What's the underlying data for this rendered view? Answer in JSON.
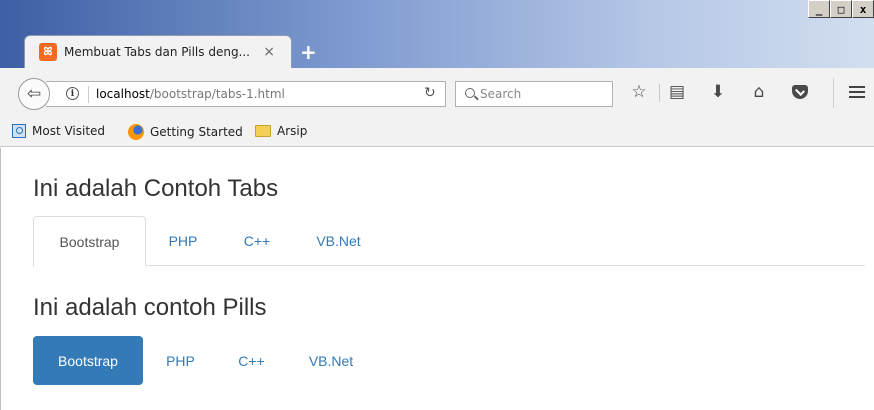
{
  "window": {
    "controls": {
      "minimize": "_",
      "maximize": "□",
      "close": "x"
    }
  },
  "browser_tab": {
    "title": "Membuat Tabs dan Pills deng...",
    "favicon_glyph": "ꕤ",
    "close_glyph": "×"
  },
  "new_tab": "+",
  "toolbar": {
    "url_host": "localhost",
    "url_path": "/bootstrap/tabs-1.html",
    "search_placeholder": "Search"
  },
  "bookmarks": [
    {
      "label": "Most Visited"
    },
    {
      "label": "Getting Started"
    },
    {
      "label": "Arsip"
    }
  ],
  "page": {
    "tabs_heading": "Ini adalah Contoh Tabs",
    "tabs": [
      {
        "label": "Bootstrap",
        "active": true
      },
      {
        "label": "PHP",
        "active": false
      },
      {
        "label": "C++",
        "active": false
      },
      {
        "label": "VB.Net",
        "active": false
      }
    ],
    "pills_heading": "Ini adalah contoh Pills",
    "pills": [
      {
        "label": "Bootstrap",
        "active": true
      },
      {
        "label": "PHP",
        "active": false
      },
      {
        "label": "C++",
        "active": false
      },
      {
        "label": "VB.Net",
        "active": false
      }
    ]
  },
  "colors": {
    "link": "#337ab7",
    "active_pill_bg": "#337ab7",
    "heading": "#333333"
  }
}
